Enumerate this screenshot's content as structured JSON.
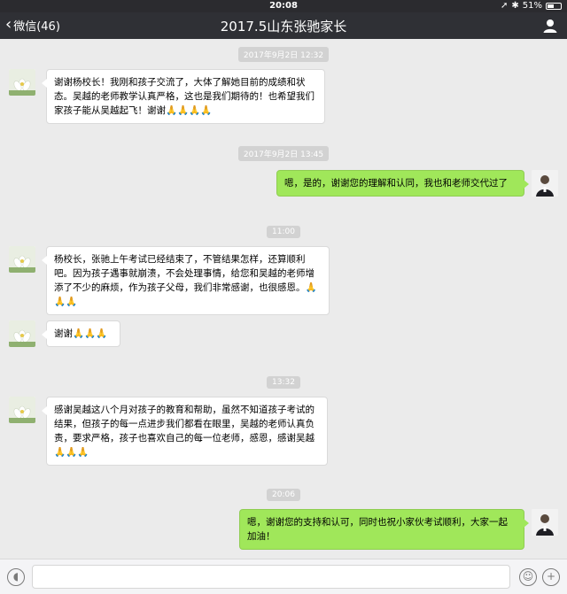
{
  "status_bar": {
    "time": "20:08",
    "battery": "51%",
    "battery_level": 0.51
  },
  "nav": {
    "back_label": "微信(46)",
    "title": "2017.5山东张驰家长"
  },
  "messages": [
    {
      "type": "timestamp",
      "text": "2017年9月2日 12:32"
    },
    {
      "type": "msg",
      "side": "left",
      "sender": "parent",
      "text": "谢谢杨校长！我刚和孩子交流了，大体了解她目前的成绩和状态。吴越的老师教学认真严格，这也是我们期待的！也希望我们家孩子能从吴越起飞！谢谢🙏🙏🙏🙏"
    },
    {
      "type": "timestamp",
      "text": "2017年9月2日 13:45"
    },
    {
      "type": "msg",
      "side": "right",
      "sender": "principal",
      "text": "嗯，是的，谢谢您的理解和认同，我也和老师交代过了"
    },
    {
      "type": "timestamp",
      "text": "11:00"
    },
    {
      "type": "msg",
      "side": "left",
      "sender": "parent",
      "text": "杨校长，张驰上午考试已经结束了，不管结果怎样，还算顺利吧。因为孩子遇事就崩溃，不会处理事情，给您和吴越的老师增添了不少的麻烦，作为孩子父母，我们非常感谢，也很感恩。🙏🙏🙏"
    },
    {
      "type": "msg",
      "side": "left",
      "sender": "parent",
      "text": "谢谢🙏🙏🙏"
    },
    {
      "type": "timestamp",
      "text": "13:32"
    },
    {
      "type": "msg",
      "side": "left",
      "sender": "parent",
      "text": "感谢吴越这八个月对孩子的教育和帮助，虽然不知道孩子考试的结果，但孩子的每一点进步我们都看在眼里，吴越的老师认真负责，要求严格，孩子也喜欢自己的每一位老师，感恩，感谢吴越🙏🙏🙏"
    },
    {
      "type": "timestamp",
      "text": "20:06"
    },
    {
      "type": "msg",
      "side": "right",
      "sender": "principal",
      "text": "嗯，谢谢您的支持和认可，同时也祝小家伙考试顺利，大家一起加油！"
    }
  ],
  "input_bar": {
    "placeholder": ""
  },
  "icons": {
    "back": "chevron-left-icon",
    "user": "user-icon",
    "voice": "voice-icon",
    "emoji": "emoji-icon",
    "add": "add-icon"
  },
  "colors": {
    "nav_bg": "#2f3035",
    "chat_bg": "#ebebeb",
    "sent_bubble": "#a0e75a",
    "received_bubble": "#ffffff",
    "timestamp_bg": "#d2d2d2"
  }
}
